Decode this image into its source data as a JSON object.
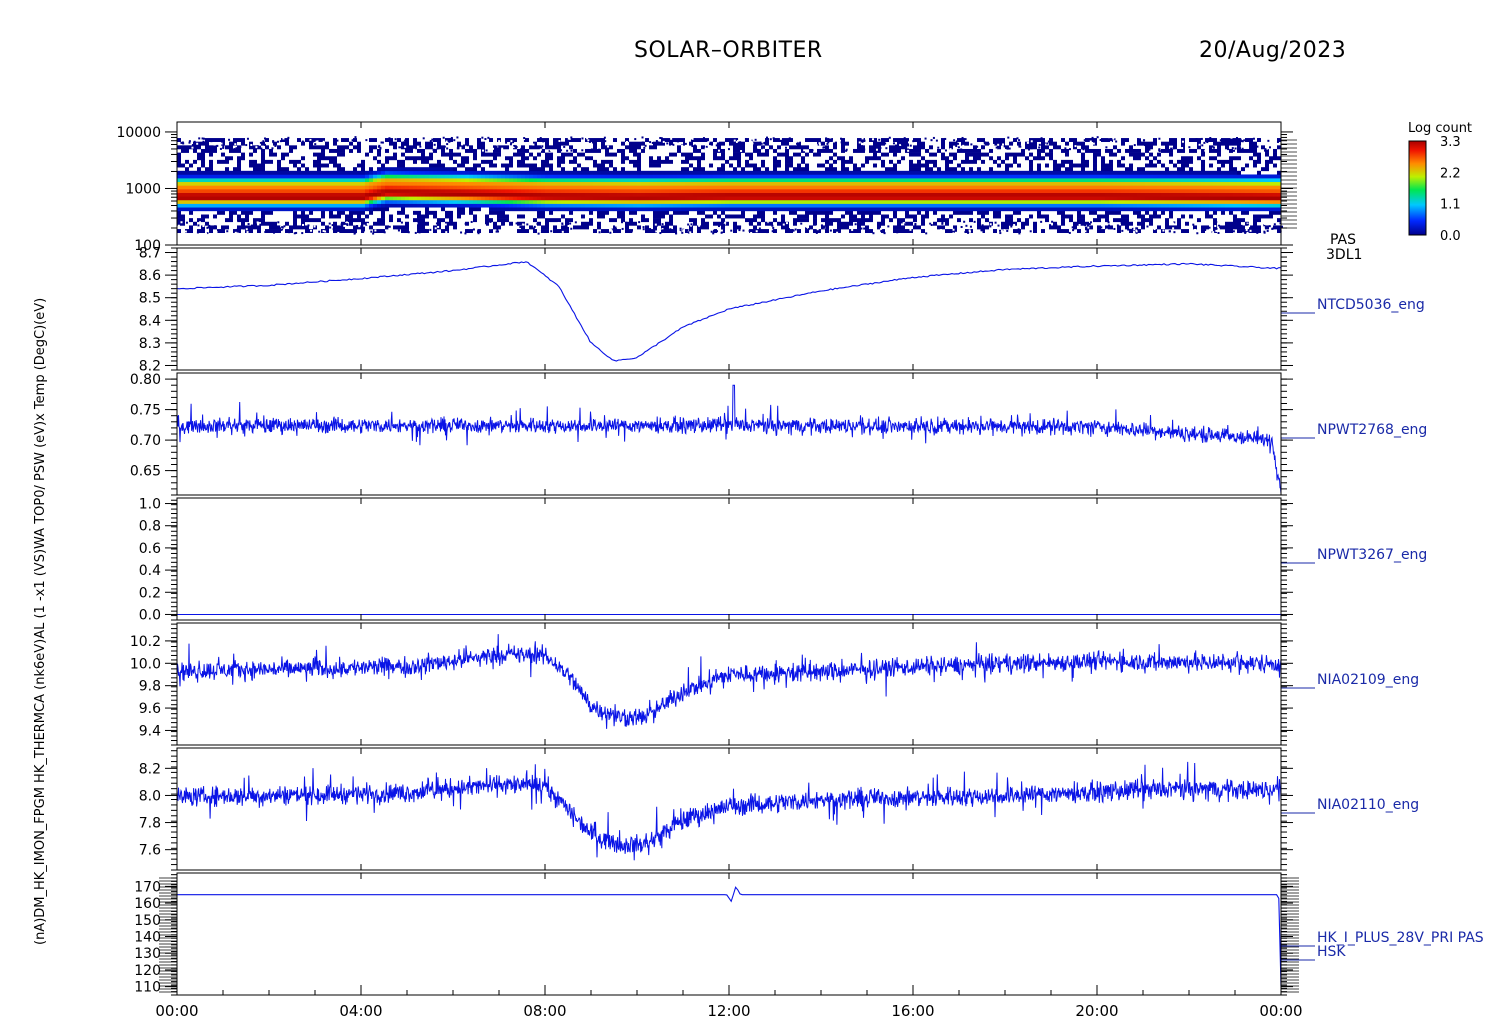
{
  "header": {
    "mission": "SOLAR–ORBITER",
    "date": "20/Aug/2023"
  },
  "colorbar": {
    "label": "Log count",
    "ticks": [
      "3.3",
      "2.2",
      "1.1",
      "0.0"
    ]
  },
  "x_ticks": [
    "00:00",
    "04:00",
    "08:00",
    "12:00",
    "16:00",
    "20:00",
    "00:00"
  ],
  "left_label": "(nA)DM_HK_IMON_FPGM  HK_THERMCA (nk6eV)AL (1 -x1 (VS)WA TOP0/ PSW (eV)x Temp (DegC)(eV)",
  "colors": {
    "trace": "#0a14e6",
    "label": "#1a2aa8",
    "axis": "#000000"
  },
  "chart_data": [
    {
      "type": "heatmap",
      "name_label": [
        "PAS",
        "3DL1"
      ],
      "ylabel": "(eV)",
      "yscale": "log",
      "ylim": [
        100,
        15000
      ],
      "y_ticks": [
        "10000",
        "1000",
        "100"
      ],
      "color_range": [
        0.0,
        3.3
      ],
      "xlim_hours": [
        0,
        24
      ],
      "ridge_energy_ev": [
        [
          0,
          700
        ],
        [
          4,
          700
        ],
        [
          4.5,
          850
        ],
        [
          6,
          800
        ],
        [
          8,
          720
        ],
        [
          10,
          700
        ],
        [
          12,
          720
        ],
        [
          16,
          720
        ],
        [
          20,
          720
        ],
        [
          24,
          680
        ]
      ]
    },
    {
      "type": "line",
      "series_label": "NTCD5036_eng",
      "ylim": [
        8.18,
        8.72
      ],
      "y_ticks": [
        "8.7",
        "8.6",
        "8.5",
        "8.4",
        "8.3",
        "8.2"
      ],
      "points": [
        [
          0,
          8.54
        ],
        [
          2,
          8.555
        ],
        [
          4,
          8.585
        ],
        [
          6,
          8.62
        ],
        [
          7.6,
          8.66
        ],
        [
          8.3,
          8.55
        ],
        [
          9.0,
          8.3
        ],
        [
          9.5,
          8.22
        ],
        [
          10,
          8.235
        ],
        [
          11,
          8.37
        ],
        [
          12,
          8.45
        ],
        [
          14,
          8.53
        ],
        [
          16,
          8.59
        ],
        [
          18,
          8.625
        ],
        [
          20,
          8.64
        ],
        [
          22,
          8.65
        ],
        [
          23.9,
          8.63
        ]
      ]
    },
    {
      "type": "line",
      "series_label": "NPWT2768_eng",
      "ylim": [
        0.61,
        0.81
      ],
      "y_ticks": [
        "0.80",
        "0.75",
        "0.70",
        "0.65"
      ],
      "points": [
        [
          0,
          0.724
        ],
        [
          12,
          0.724
        ],
        [
          20,
          0.722
        ],
        [
          23.8,
          0.7
        ],
        [
          24.0,
          0.62
        ]
      ],
      "noise": 0.012,
      "spike": [
        12.1,
        0.79
      ]
    },
    {
      "type": "line",
      "series_label": "NPWT3267_eng",
      "ylim": [
        -0.05,
        1.05
      ],
      "y_ticks": [
        "1.0",
        "0.8",
        "0.6",
        "0.4",
        "0.2",
        "0.0"
      ],
      "points": [
        [
          0,
          0.0
        ],
        [
          24,
          0.0
        ]
      ]
    },
    {
      "type": "line",
      "series_label": "NIA02109_eng",
      "ylim": [
        9.27,
        10.36
      ],
      "y_ticks": [
        "10.2",
        "10.0",
        "9.8",
        "9.6",
        "9.4"
      ],
      "points": [
        [
          0,
          9.93
        ],
        [
          5,
          9.97
        ],
        [
          7,
          10.08
        ],
        [
          8,
          10.07
        ],
        [
          8.5,
          9.9
        ],
        [
          9,
          9.62
        ],
        [
          9.6,
          9.52
        ],
        [
          10.2,
          9.52
        ],
        [
          11,
          9.75
        ],
        [
          12,
          9.9
        ],
        [
          14,
          9.92
        ],
        [
          16,
          9.97
        ],
        [
          20,
          10.02
        ],
        [
          23.9,
          10.0
        ]
      ],
      "noise": 0.08
    },
    {
      "type": "line",
      "series_label": "NIA02110_eng",
      "ylim": [
        7.45,
        8.35
      ],
      "y_ticks": [
        "8.2",
        "8.0",
        "7.8",
        "7.6"
      ],
      "points": [
        [
          0,
          7.99
        ],
        [
          5,
          8.02
        ],
        [
          7,
          8.08
        ],
        [
          8,
          8.07
        ],
        [
          8.5,
          7.9
        ],
        [
          9,
          7.72
        ],
        [
          9.6,
          7.64
        ],
        [
          10.2,
          7.64
        ],
        [
          11,
          7.82
        ],
        [
          12,
          7.92
        ],
        [
          14,
          7.97
        ],
        [
          18,
          8.0
        ],
        [
          22,
          8.05
        ],
        [
          23.9,
          8.04
        ]
      ],
      "noise": 0.07
    },
    {
      "type": "line",
      "series_labels": [
        "HK_I_PLUS_28V_PRI PAS",
        "HSK"
      ],
      "ylim": [
        105,
        178
      ],
      "y_ticks": [
        "170",
        "160",
        "150",
        "140",
        "130",
        "120",
        "110"
      ],
      "points": [
        [
          0,
          165
        ],
        [
          11.95,
          165
        ],
        [
          12.05,
          161
        ],
        [
          12.15,
          170
        ],
        [
          12.25,
          165
        ],
        [
          23.95,
          165
        ],
        [
          24.0,
          110
        ]
      ]
    }
  ]
}
